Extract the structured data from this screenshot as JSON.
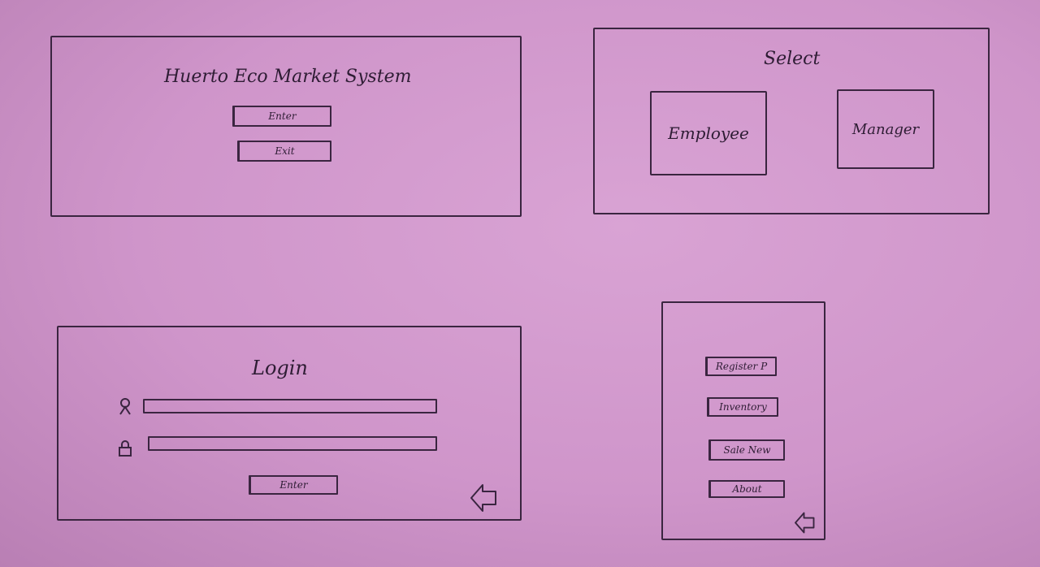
{
  "welcome": {
    "title": "Huerto Eco Market System",
    "enter_label": "Enter",
    "exit_label": "Exit"
  },
  "select": {
    "title": "Select",
    "employee_label": "Employee",
    "manager_label": "Manager"
  },
  "login": {
    "title": "Login",
    "username_icon": "user-icon",
    "password_icon": "lock-icon",
    "enter_label": "Enter",
    "back_icon": "back-arrow-icon"
  },
  "menu": {
    "items": [
      {
        "label": "Register P"
      },
      {
        "label": "Inventory"
      },
      {
        "label": "Sale New"
      },
      {
        "label": "About"
      }
    ],
    "back_icon": "back-arrow-icon"
  }
}
